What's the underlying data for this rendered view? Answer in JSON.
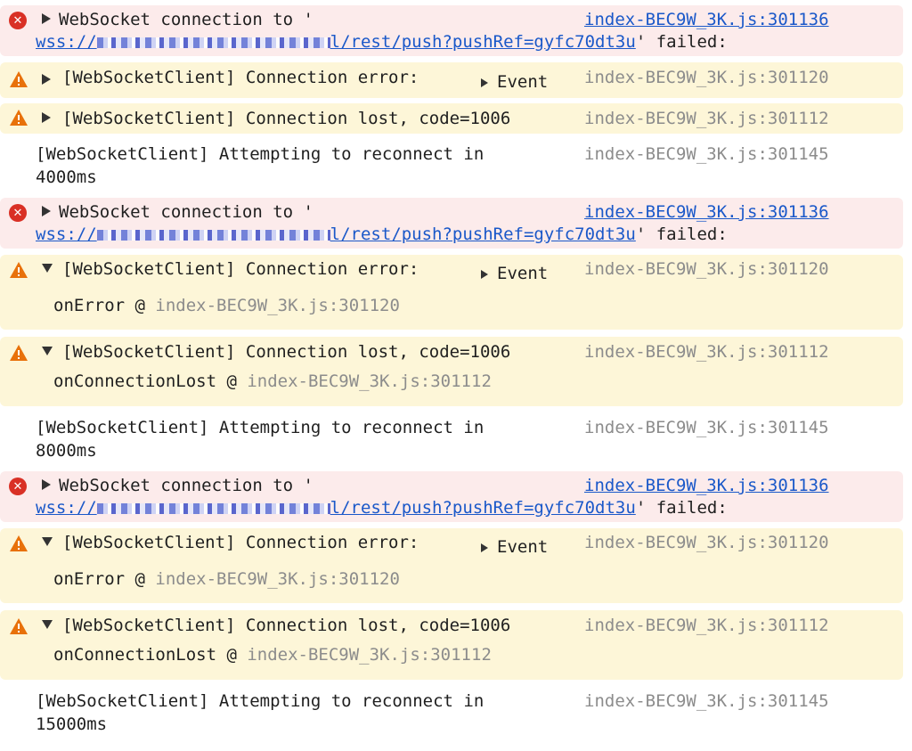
{
  "ws_error": {
    "prefix": "WebSocket connection to '",
    "url_start": "wss://",
    "url_end": "l/rest/push?pushRef=gyfc70dt3u",
    "suffix": "' failed:",
    "source": "index-BEC9W_3K.js:301136"
  },
  "conn_error": {
    "text": "[WebSocketClient] Connection error:",
    "event_label": "Event",
    "source": "index-BEC9W_3K.js:301120",
    "trace_fn": "onError @ ",
    "trace_src": "index-BEC9W_3K.js:301120"
  },
  "conn_lost": {
    "text": "[WebSocketClient] Connection lost, code=1006",
    "source": "index-BEC9W_3K.js:301112",
    "trace_fn": "onConnectionLost @ ",
    "trace_src": "index-BEC9W_3K.js:301112"
  },
  "reconnect": {
    "text": "[WebSocketClient] Attempting to reconnect in",
    "source": "index-BEC9W_3K.js:301145",
    "delays": [
      "4000ms",
      "8000ms",
      "15000ms"
    ]
  },
  "colors": {
    "error_bg": "#fcebeb",
    "warn_bg": "#fdf6d8",
    "link": "#1a58c9",
    "error_icon": "#d93025",
    "warn_icon": "#e8710a"
  }
}
